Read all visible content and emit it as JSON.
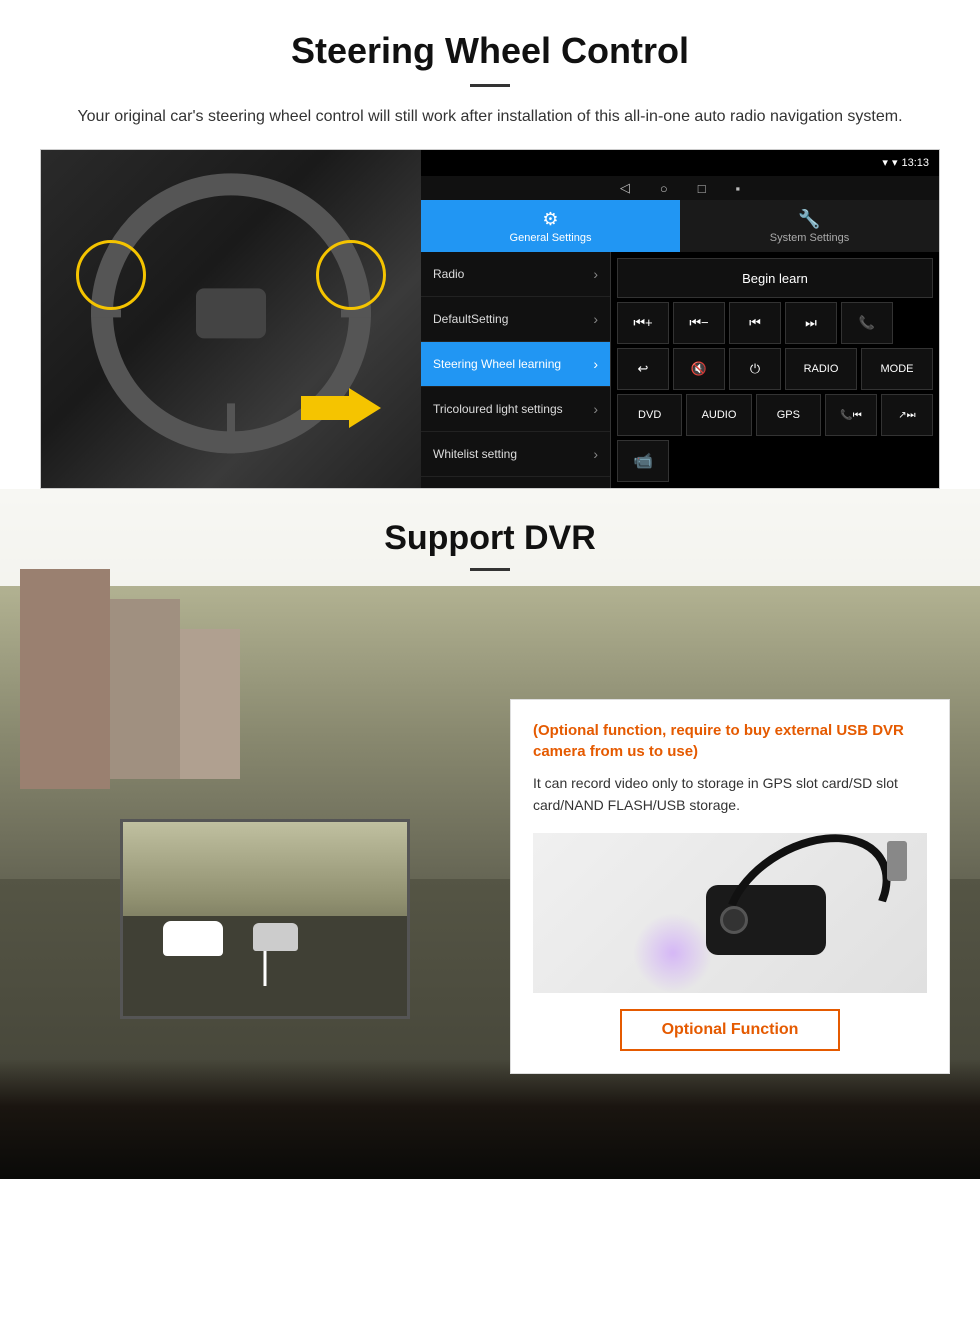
{
  "steering_section": {
    "title": "Steering Wheel Control",
    "subtitle": "Your original car's steering wheel control will still work after installation of this all-in-one auto radio navigation system.",
    "android_ui": {
      "statusbar": {
        "time": "13:13",
        "signal_icon": "▼",
        "wifi_icon": "▾"
      },
      "nav_icons": [
        "◁",
        "○",
        "□",
        "▪"
      ],
      "tabs": [
        {
          "id": "general",
          "label": "General Settings",
          "icon": "⚙"
        },
        {
          "id": "system",
          "label": "System Settings",
          "icon": "🔧"
        }
      ],
      "menu_items": [
        {
          "label": "Radio",
          "active": false
        },
        {
          "label": "DefaultSetting",
          "active": false
        },
        {
          "label": "Steering Wheel learning",
          "active": true
        },
        {
          "label": "Tricoloured light settings",
          "active": false
        },
        {
          "label": "Whitelist setting",
          "active": false
        }
      ],
      "begin_learn_label": "Begin learn",
      "control_buttons": [
        [
          "vol+",
          "vol-",
          "prev",
          "next",
          "call"
        ],
        [
          "hangup",
          "mute",
          "power",
          "RADIO",
          "MODE"
        ],
        [
          "DVD",
          "AUDIO",
          "GPS",
          "prev-call",
          "next-skip"
        ],
        [
          "dvr-icon"
        ]
      ]
    }
  },
  "dvr_section": {
    "title": "Support DVR",
    "optional_text": "(Optional function, require to buy external USB DVR camera from us to use)",
    "description": "It can record video only to storage in GPS slot card/SD slot card/NAND FLASH/USB storage.",
    "optional_button_label": "Optional Function"
  }
}
